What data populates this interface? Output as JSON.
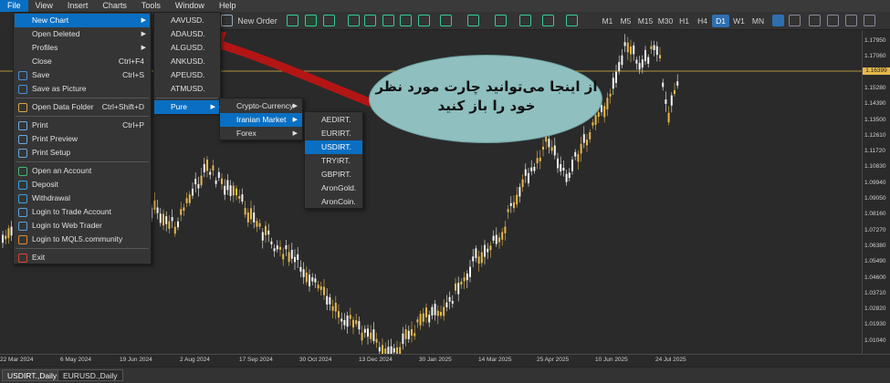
{
  "menubar": [
    "File",
    "View",
    "Insert",
    "Charts",
    "Tools",
    "Window",
    "Help"
  ],
  "toolbar": {
    "new_order": "New Order",
    "autotrading": "Algo Trading"
  },
  "timeframes": [
    "M1",
    "M5",
    "M15",
    "M30",
    "H1",
    "H4",
    "D1",
    "W1",
    "MN"
  ],
  "active_timeframe": "D1",
  "file_menu": [
    {
      "label": "New Chart",
      "shortcut": "",
      "submenu": true,
      "icon": "none"
    },
    {
      "label": "Open Deleted",
      "shortcut": "",
      "submenu": true,
      "icon": "none"
    },
    {
      "label": "Profiles",
      "shortcut": "",
      "submenu": true,
      "icon": "none"
    },
    {
      "label": "Close",
      "shortcut": "Ctrl+F4",
      "submenu": false,
      "icon": "none"
    },
    {
      "label": "Save",
      "shortcut": "Ctrl+S",
      "submenu": false,
      "icon": "save-icon"
    },
    {
      "label": "Save as Picture",
      "shortcut": "",
      "submenu": false,
      "icon": "picture-icon"
    },
    {
      "label": "Open Data Folder",
      "shortcut": "Ctrl+Shift+D",
      "submenu": false,
      "icon": "folder-icon"
    },
    {
      "label": "Print",
      "shortcut": "Ctrl+P",
      "submenu": false,
      "icon": "print-icon"
    },
    {
      "label": "Print Preview",
      "shortcut": "",
      "submenu": false,
      "icon": "print-preview-icon"
    },
    {
      "label": "Print Setup",
      "shortcut": "",
      "submenu": false,
      "icon": "print-setup-icon"
    },
    {
      "label": "Open an Account",
      "shortcut": "",
      "submenu": false,
      "icon": "plus-icon"
    },
    {
      "label": "Deposit",
      "shortcut": "",
      "submenu": false,
      "icon": "deposit-icon"
    },
    {
      "label": "Withdrawal",
      "shortcut": "",
      "submenu": false,
      "icon": "withdrawal-icon"
    },
    {
      "label": "Login to Trade Account",
      "shortcut": "",
      "submenu": false,
      "icon": "user-icon"
    },
    {
      "label": "Login to Web Trader",
      "shortcut": "",
      "submenu": false,
      "icon": "globe-icon"
    },
    {
      "label": "Login to MQL5.community",
      "shortcut": "",
      "submenu": false,
      "icon": "mql5-icon"
    },
    {
      "label": "Exit",
      "shortcut": "",
      "submenu": false,
      "icon": "exit-icon"
    }
  ],
  "symbol_menu": [
    "AAVUSD.",
    "ADAUSD.",
    "ALGUSD.",
    "ANKUSD.",
    "APEUSD.",
    "ATMUSD.",
    "Pure"
  ],
  "pure_menu": [
    "Crypto-Currency",
    "Iranian Market",
    "Forex"
  ],
  "iranian_menu": [
    "AEDIRT.",
    "EURIRT.",
    "USDIRT.",
    "TRYIRT.",
    "GBPIRT.",
    "AronGold.",
    "AronCoin."
  ],
  "callout_text": "از اینجا می‌توانید چارت مورد نظر خود را باز کنید",
  "price_current": "1.16399",
  "y_ticks": [
    "1.17950",
    "1.17060",
    "1.16170",
    "1.15280",
    "1.14390",
    "1.13500",
    "1.12610",
    "1.11720",
    "1.10830",
    "1.09940",
    "1.09050",
    "1.08160",
    "1.07270",
    "1.06380",
    "1.05490",
    "1.04600",
    "1.03710",
    "1.02820",
    "1.01930",
    "1.01040"
  ],
  "x_ticks": [
    "22 Mar 2024",
    "6 May 2024",
    "19 Jun 2024",
    "2 Aug 2024",
    "17 Sep 2024",
    "30 Oct 2024",
    "13 Dec 2024",
    "30 Jan 2025",
    "14 Mar 2025",
    "25 Apr 2025",
    "10 Jun 2025",
    "24 Jul 2025"
  ],
  "tabs": [
    "USDIRT.,Daily",
    "EURUSD.,Daily"
  ],
  "colors": {
    "accent": "#0a6fc2",
    "bull": "#e6b84a",
    "bear": "#f2f2f2",
    "callout": "#8fbfbf",
    "arrow": "#b31515"
  }
}
